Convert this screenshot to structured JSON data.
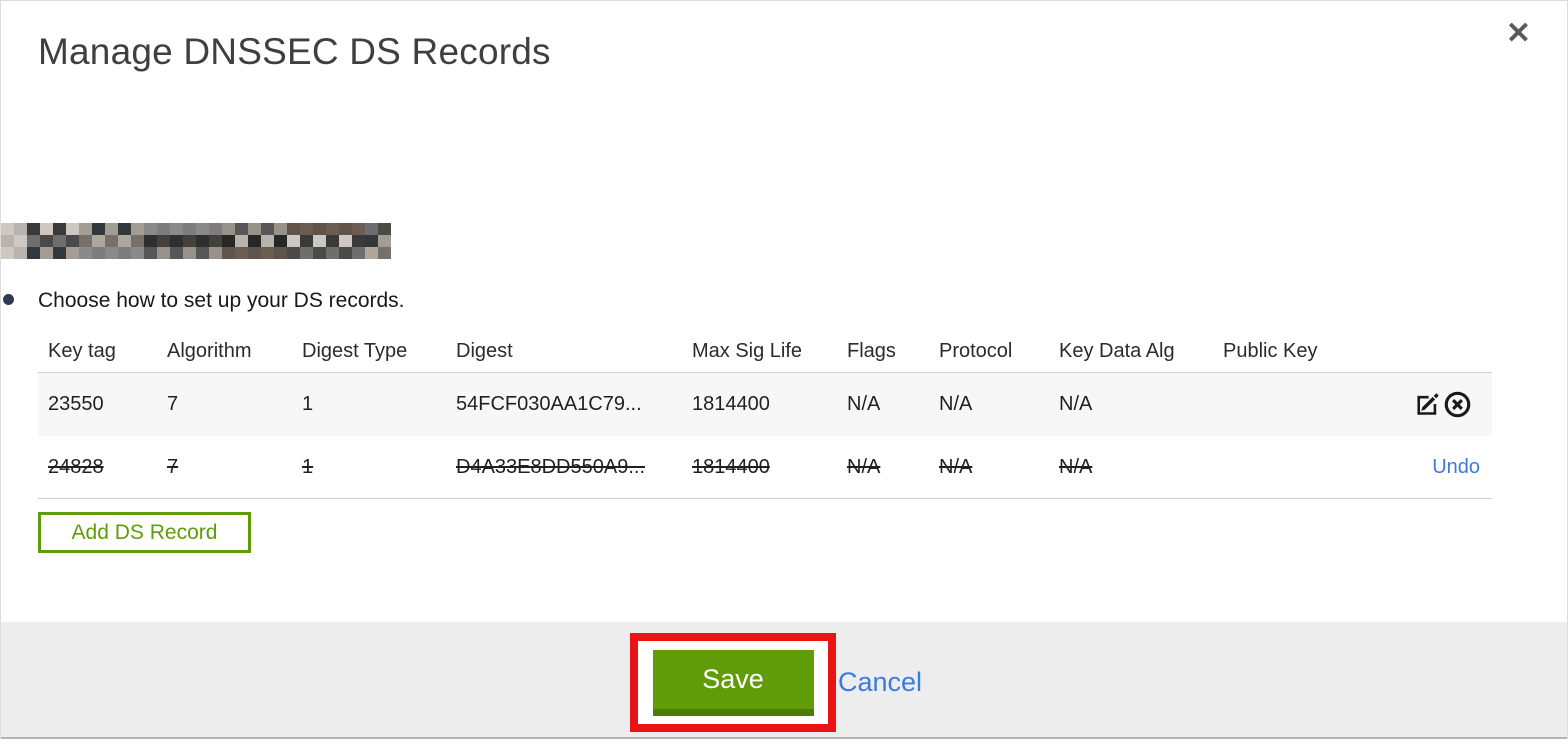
{
  "dialog": {
    "title": "Manage DNSSEC DS Records",
    "close_label": "✕",
    "instruction": "Choose how to set up your DS records.",
    "domain_redacted": true
  },
  "table": {
    "columns": [
      "Key tag",
      "Algorithm",
      "Digest Type",
      "Digest",
      "Max Sig Life",
      "Flags",
      "Protocol",
      "Key Data Alg",
      "Public Key"
    ],
    "rows": [
      {
        "key_tag": "23550",
        "algorithm": "7",
        "digest_type": "1",
        "digest": "54FCF030AA1C79...",
        "max_sig_life": "1814400",
        "flags": "N/A",
        "protocol": "N/A",
        "key_data_alg": "N/A",
        "public_key": "",
        "state": "normal",
        "actions": [
          "edit-icon",
          "delete-icon"
        ]
      },
      {
        "key_tag": "24828",
        "algorithm": "7",
        "digest_type": "1",
        "digest": "D4A33E8DD550A9...",
        "max_sig_life": "1814400",
        "flags": "N/A",
        "protocol": "N/A",
        "key_data_alg": "N/A",
        "public_key": "",
        "state": "deleted-strikethrough",
        "undo_label": "Undo"
      }
    ]
  },
  "buttons": {
    "add_ds_record": "Add DS Record",
    "save": "Save",
    "cancel": "Cancel"
  },
  "annotations": {
    "save_highlight_box_color": "#ea1417"
  },
  "colors": {
    "accent_green": "#5f9c08",
    "accent_green_dark": "#4c7d05",
    "link_blue": "#3b7be0",
    "footer_gray": "#ededed",
    "row_stripe": "#f7f7f7",
    "border_gray": "#cfcfcf",
    "title_gray": "#3f3f3f",
    "text_dark": "#16191f",
    "icon_dark": "#1a1a1a"
  },
  "redaction": {
    "palette": [
      "#3a3a3a",
      "#6b5d52",
      "#b9b3ad",
      "#565656",
      "#2f2f2f",
      "#8a8a8a",
      "#757068",
      "#a39d96",
      "#4a4a48",
      "#cdc8c2",
      "#5d554c",
      "#272727",
      "#97918a",
      "#44403b",
      "#7d7d7d",
      "#b0a79c",
      "#33383d",
      "#6e6e6e"
    ]
  }
}
